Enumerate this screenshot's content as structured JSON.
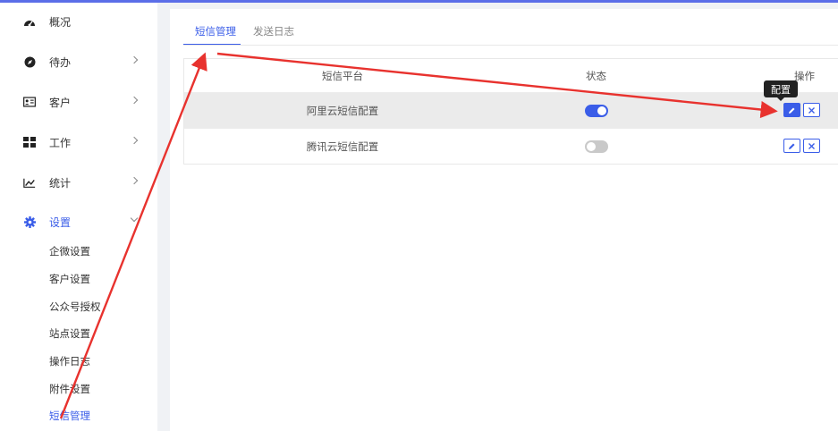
{
  "sidebar": {
    "items": [
      {
        "label": "概况",
        "icon": "dashboard-icon"
      },
      {
        "label": "待办",
        "icon": "compass-icon"
      },
      {
        "label": "客户",
        "icon": "contact-card-icon"
      },
      {
        "label": "工作",
        "icon": "grid-icon"
      },
      {
        "label": "统计",
        "icon": "line-chart-icon"
      },
      {
        "label": "设置",
        "icon": "gear-icon"
      }
    ],
    "settings_sub": [
      "企微设置",
      "客户设置",
      "公众号授权",
      "站点设置",
      "操作日志",
      "附件设置",
      "短信管理"
    ]
  },
  "tabs": [
    "短信管理",
    "发送日志"
  ],
  "table": {
    "headers": [
      "短信平台",
      "状态",
      "操作"
    ],
    "rows": [
      {
        "platform": "阿里云短信配置",
        "enabled": true
      },
      {
        "platform": "腾讯云短信配置",
        "enabled": false
      }
    ]
  },
  "tooltip": "配置",
  "colors": {
    "accent": "#3a5de8",
    "annotation": "#e8322e"
  }
}
